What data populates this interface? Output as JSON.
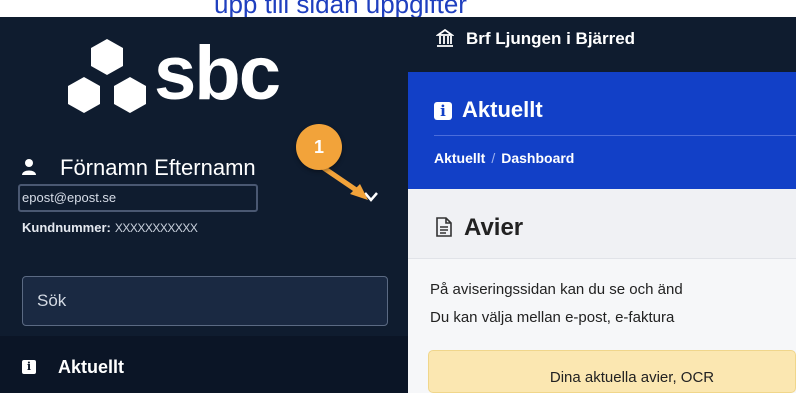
{
  "top_fragment": "upp till sidan uppgifter",
  "logo": {
    "text": "sbc"
  },
  "user": {
    "name": "Förnamn Efternamn",
    "email": "epost@epost.se",
    "kund_label": "Kundnummer:",
    "kund_value": "XXXXXXXXXXX"
  },
  "annotation": {
    "badge_number": "1",
    "color": "#f2a33a"
  },
  "search": {
    "placeholder": "Sök"
  },
  "nav": {
    "active_label": "Aktuellt"
  },
  "topbar": {
    "org_name": "Brf Ljungen i Bjärred"
  },
  "header": {
    "title": "Aktuellt",
    "breadcrumb": {
      "first": "Aktuellt",
      "separator": "/",
      "current": "Dashboard"
    }
  },
  "content": {
    "section_title": "Avier",
    "text_line_1": "På aviseringssidan kan du se och änd",
    "text_line_2": "Du kan välja mellan e-post, e-faktura",
    "notice": "Dina aktuella avier, OCR"
  },
  "colors": {
    "sidebar_bg": "#0f1c2f",
    "header_blue": "#1240c7",
    "notice_bg": "#fbe7b1",
    "accent_orange": "#f2a33a"
  },
  "icons": [
    "cubes-logo-icon",
    "user-icon",
    "chevron-down-icon",
    "info-icon",
    "building-icon",
    "document-icon"
  ]
}
